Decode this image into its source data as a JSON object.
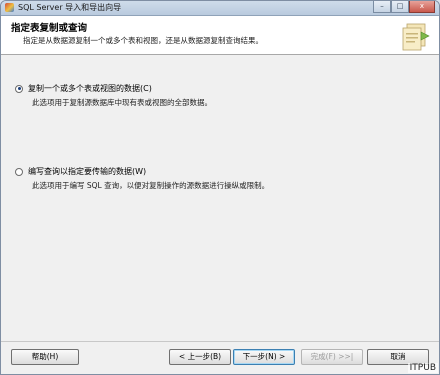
{
  "window": {
    "title": "SQL Server 导入和导出向导",
    "minimize_glyph": "–",
    "maximize_glyph": "□",
    "close_glyph": "x"
  },
  "header": {
    "title": "指定表复制或查询",
    "subtitle": "指定是从数据源复制一个或多个表和视图，还是从数据源复制查询结果。"
  },
  "options": [
    {
      "label": "复制一个或多个表或视图的数据(C)",
      "description": "此选项用于复制源数据库中现有表或视图的全部数据。",
      "selected": true
    },
    {
      "label": "编写查询以指定要传输的数据(W)",
      "description": "此选项用于编写 SQL 查询，以便对复制操作的源数据进行操纵或限制。",
      "selected": false
    }
  ],
  "footer": {
    "help_label": "帮助(H)",
    "back_label": "< 上一步(B)",
    "next_label": "下一步(N) >",
    "finish_label": "完成(F) >>|",
    "cancel_label": "取消"
  },
  "watermark": "ITPUB",
  "colors": {
    "accent": "#1d3f7a",
    "titlebar": "#c5d4e5"
  }
}
